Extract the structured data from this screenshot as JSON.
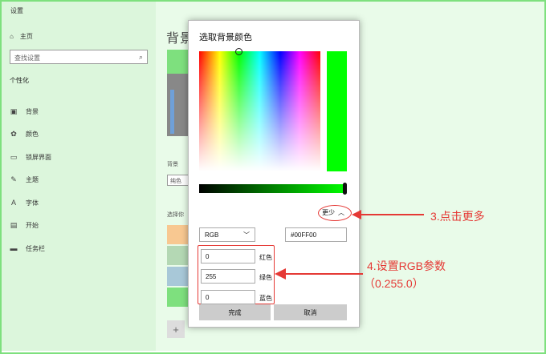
{
  "window": {
    "title": "设置",
    "controls": {
      "minimize": "—",
      "maximize": "☐",
      "close": "✕"
    }
  },
  "sidebar": {
    "home": "主页",
    "search_placeholder": "查找设置",
    "section": "个性化",
    "items": [
      {
        "icon": "▣",
        "label": "背景"
      },
      {
        "icon": "✿",
        "label": "颜色"
      },
      {
        "icon": "▭",
        "label": "锁屏界面"
      },
      {
        "icon": "✎",
        "label": "主题"
      },
      {
        "icon": "A",
        "label": "字体"
      },
      {
        "icon": "▤",
        "label": "开始"
      },
      {
        "icon": "▬",
        "label": "任务栏"
      }
    ]
  },
  "content": {
    "title": "背景",
    "bg_label": "背景",
    "bg_select": "纯色",
    "choose_label": "选择你",
    "swatches": [
      "#f8c891",
      "#b4d8b4",
      "#a8c8d8",
      "#7ee07e"
    ],
    "plus": "+"
  },
  "dialog": {
    "title": "选取背景颜色",
    "preview_color": "#00ff00",
    "more_label": "更少",
    "mode": "RGB",
    "hex": "#00FF00",
    "red": {
      "value": "0",
      "label": "红色"
    },
    "green": {
      "value": "255",
      "label": "绿色"
    },
    "blue": {
      "value": "0",
      "label": "蓝色"
    },
    "done": "完成",
    "cancel": "取消"
  },
  "annotations": {
    "step3": "3.点击更多",
    "step4_line1": "4.设置RGB参数",
    "step4_line2": "（0.255.0）",
    "color": "#e53935"
  }
}
